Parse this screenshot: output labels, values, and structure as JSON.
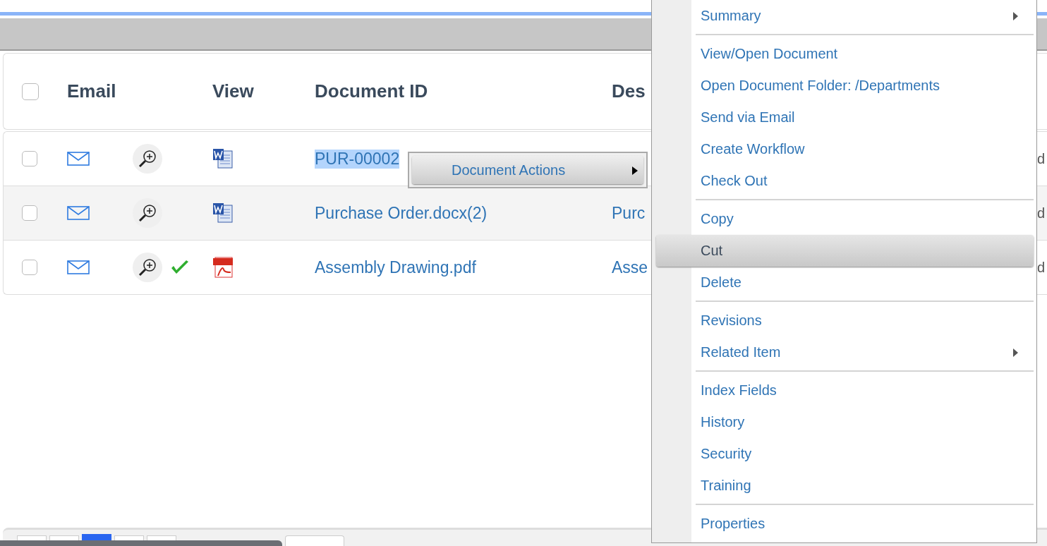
{
  "table": {
    "header": {
      "checked": false,
      "columns": [
        "Email",
        "View",
        "Document ID",
        "Des"
      ]
    },
    "rows": [
      {
        "checked": false,
        "kind": "word",
        "approved": false,
        "document_id": "PUR-00002",
        "highlighted": true,
        "column_8": "d"
      },
      {
        "checked": false,
        "kind": "word",
        "approved": false,
        "document_id": "Purchase Order.docx(2)",
        "highlighted": false,
        "description": "Purc",
        "column_8": "d"
      },
      {
        "checked": false,
        "kind": "pdf",
        "approved": true,
        "document_id": "Assembly Drawing.pdf",
        "highlighted": false,
        "description": "Asse",
        "column_8": "d"
      }
    ]
  },
  "submenu": {
    "label": "Document Actions",
    "has_submenu": true
  },
  "context_menu": {
    "groups": [
      [
        {
          "label": "Summary",
          "selected": false,
          "has_submenu": true
        }
      ],
      [
        {
          "label": "View/Open Document",
          "selected": false,
          "has_submenu": false
        },
        {
          "label": "Open Document Folder: /Departments",
          "selected": false,
          "has_submenu": false
        },
        {
          "label": "Send via Email",
          "selected": false,
          "has_submenu": false
        },
        {
          "label": "Create Workflow",
          "selected": false,
          "has_submenu": false
        },
        {
          "label": "Check Out",
          "selected": false,
          "has_submenu": false
        }
      ],
      [
        {
          "label": "Copy",
          "selected": false,
          "has_submenu": false
        },
        {
          "label": "Cut",
          "selected": true,
          "has_submenu": false
        },
        {
          "label": "Delete",
          "selected": false,
          "has_submenu": false
        }
      ],
      [
        {
          "label": "Revisions",
          "selected": false,
          "has_submenu": false
        },
        {
          "label": "Related Item",
          "selected": false,
          "has_submenu": true
        }
      ],
      [
        {
          "label": "Index Fields",
          "selected": false,
          "has_submenu": false
        },
        {
          "label": "History",
          "selected": false,
          "has_submenu": false
        },
        {
          "label": "Security",
          "selected": false,
          "has_submenu": false
        },
        {
          "label": "Training",
          "selected": false,
          "has_submenu": false
        }
      ],
      [
        {
          "label": "Properties",
          "selected": false,
          "has_submenu": false
        }
      ]
    ]
  },
  "pagination": {
    "pages": [
      {
        "selected": false
      },
      {
        "selected": false
      },
      {
        "selected": true
      },
      {
        "selected": false
      },
      {
        "selected": false
      }
    ]
  }
}
